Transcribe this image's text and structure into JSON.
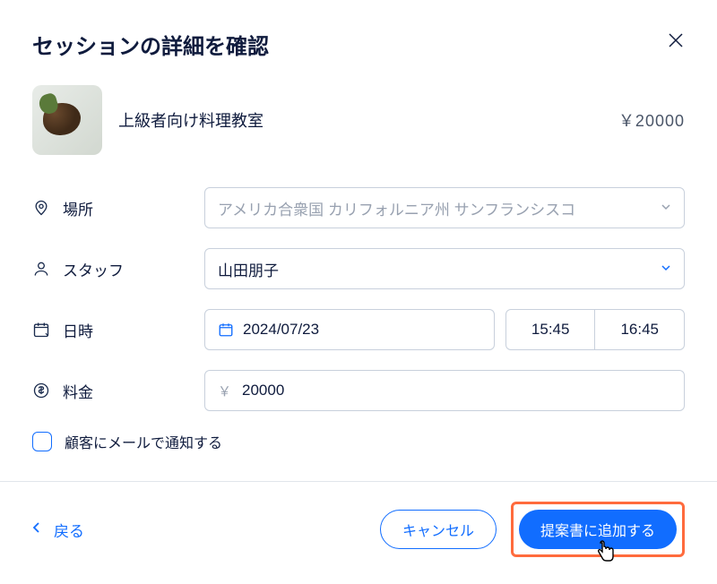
{
  "dialog": {
    "title": "セッションの詳細を確認"
  },
  "product": {
    "name": "上級者向け料理教室",
    "price_display": "￥20000"
  },
  "fields": {
    "location": {
      "label": "場所",
      "value": "アメリカ合衆国 カリフォルニア州 サンフランシスコ"
    },
    "staff": {
      "label": "スタッフ",
      "value": "山田朋子"
    },
    "datetime": {
      "label": "日時",
      "date": "2024/07/23",
      "start_time": "15:45",
      "end_time": "16:45"
    },
    "price": {
      "label": "料金",
      "currency_symbol": "￥",
      "value": "20000"
    }
  },
  "checkbox": {
    "label": "顧客にメールで通知する",
    "checked": false
  },
  "footer": {
    "back": "戻る",
    "cancel": "キャンセル",
    "submit": "提案書に追加する"
  }
}
